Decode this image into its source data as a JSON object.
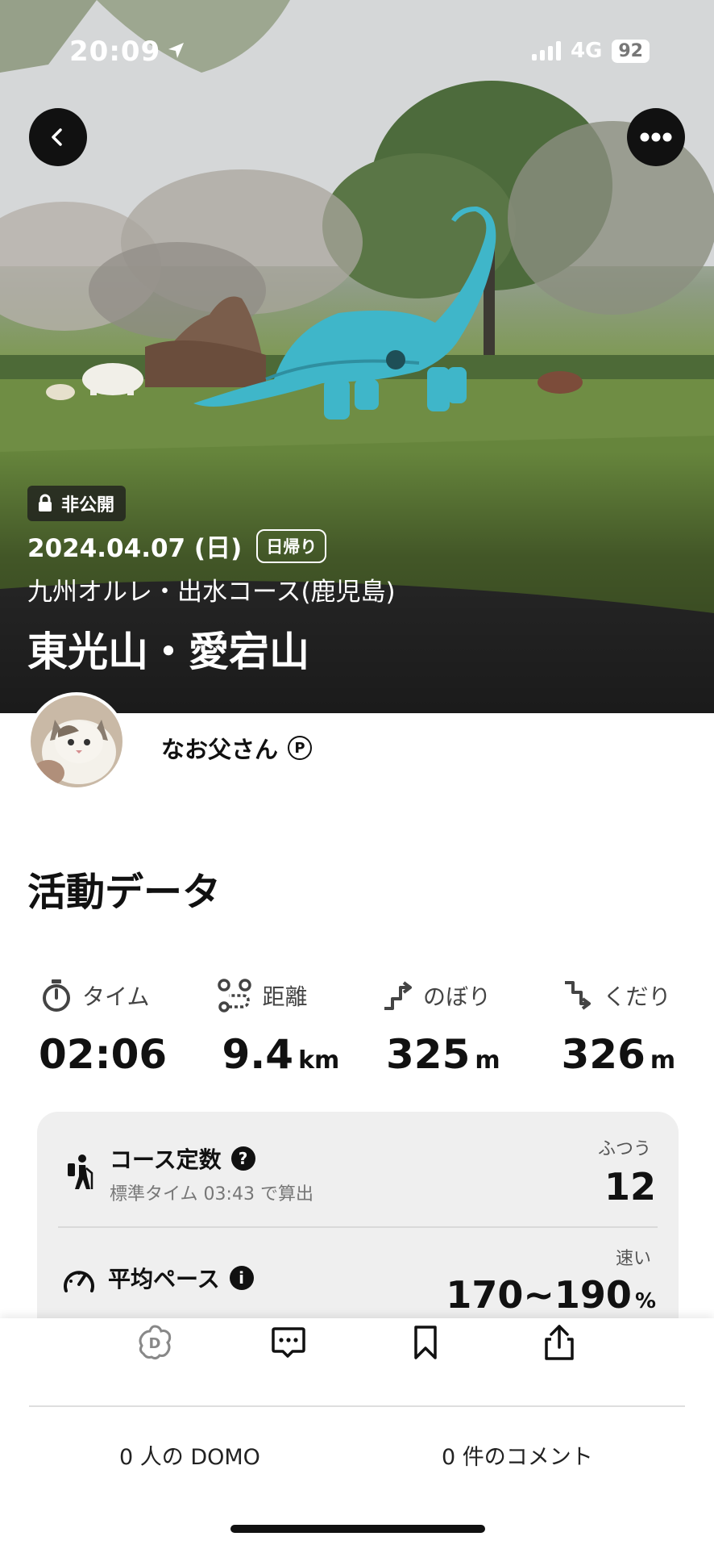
{
  "status_bar": {
    "time": "20:09",
    "network": "4G",
    "battery": "92"
  },
  "hero": {
    "privacy_badge": "非公開",
    "date": "2024.04.07 (日)",
    "trip_type": "日帰り",
    "course": "九州オルレ・出水コース(鹿児島)",
    "title": "東光山・愛宕山"
  },
  "user": {
    "name": "なお父さん",
    "badge": "P"
  },
  "activity": {
    "title": "活動データ",
    "stats": [
      {
        "icon": "stopwatch-icon",
        "label": "タイム",
        "value": "02:06",
        "unit": ""
      },
      {
        "icon": "route-icon",
        "label": "距離",
        "value": "9.4",
        "unit": "km"
      },
      {
        "icon": "ascent-icon",
        "label": "のぼり",
        "value": "325",
        "unit": "m"
      },
      {
        "icon": "descent-icon",
        "label": "くだり",
        "value": "326",
        "unit": "m"
      }
    ],
    "course_constant": {
      "label": "コース定数",
      "help": "?",
      "sub": "標準タイム 03:43 で算出",
      "level": "ふつう",
      "value": "12"
    },
    "average_pace": {
      "label": "平均ペース",
      "info": "i",
      "level": "速い",
      "value": "170~190",
      "unit": "%"
    }
  },
  "bottom": {
    "domo_count": "0 人の DOMO",
    "comment_count": "0 件のコメント"
  },
  "colors": {
    "dinosaur": "#3fb6c9",
    "grass": "#6f8d44",
    "card_bg": "#efefef"
  }
}
